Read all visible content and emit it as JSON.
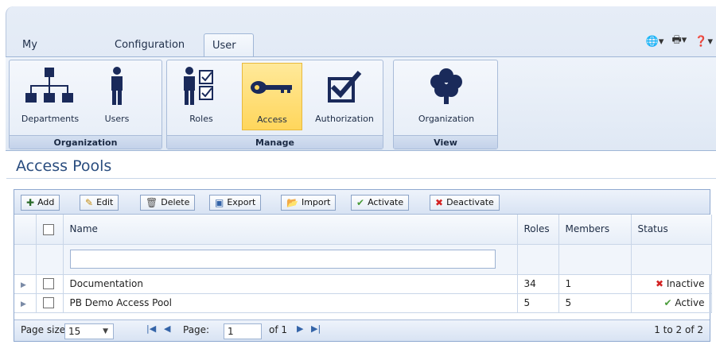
{
  "tabs": [
    "My Account",
    "Configuration",
    "User Admin"
  ],
  "active_tab": "User Admin",
  "groups": {
    "organization": {
      "label": "Organization",
      "buttons": [
        "Departments",
        "Users"
      ]
    },
    "manage": {
      "label": "Manage",
      "buttons": [
        "Roles",
        "Access",
        "Authorization"
      ]
    },
    "view": {
      "label": "View",
      "buttons": [
        "Organization"
      ]
    }
  },
  "selected_button": "Access",
  "page_title": "Access Pools",
  "toolbar": [
    "Add",
    "Edit",
    "Delete",
    "Export",
    "Import",
    "Activate",
    "Deactivate"
  ],
  "columns": [
    "Name",
    "Roles",
    "Members",
    "Status"
  ],
  "rows": [
    {
      "name": "Documentation",
      "roles": "34",
      "members": "1",
      "status": "Inactive"
    },
    {
      "name": "PB Demo Access Pool",
      "roles": "5",
      "members": "5",
      "status": "Active"
    }
  ],
  "pager": {
    "page_size_label": "Page size:",
    "page_size": "15",
    "page_label": "Page:",
    "page": "1",
    "of_label": "of 1",
    "count": "1 to 2 of 2"
  },
  "colors": {
    "title": "#2a4d7f",
    "selected": "#ffd65c",
    "inactive": "#d32222",
    "active": "#4a9c3a"
  }
}
